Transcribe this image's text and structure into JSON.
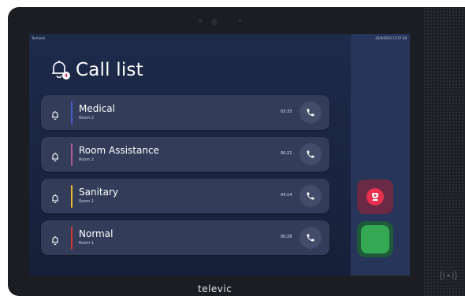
{
  "device": {
    "brand": "televic"
  },
  "statusbar": {
    "terminal_label": "Terminal",
    "datetime": "22/9/2023 11:57:16"
  },
  "header": {
    "title": "Call list",
    "badge_count": "4",
    "icon": "bell-icon"
  },
  "calls": [
    {
      "name": "Medical",
      "room": "Room 2",
      "duration": "02:33",
      "stripe_color": "#4a5bc9"
    },
    {
      "name": "Room Assistance",
      "room": "Room 2",
      "duration": "00:21",
      "stripe_color": "#b05a9e"
    },
    {
      "name": "Sanitary",
      "room": "Room 1",
      "duration": "04:14",
      "stripe_color": "#e8b92a"
    },
    {
      "name": "Normal",
      "room": "Room 1",
      "duration": "00:28",
      "stripe_color": "#d13838"
    }
  ],
  "colors": {
    "screen_bg": "#1e2a4a",
    "side_panel": "#27355a",
    "cancel": "#e8314f",
    "accept": "#34a853"
  }
}
